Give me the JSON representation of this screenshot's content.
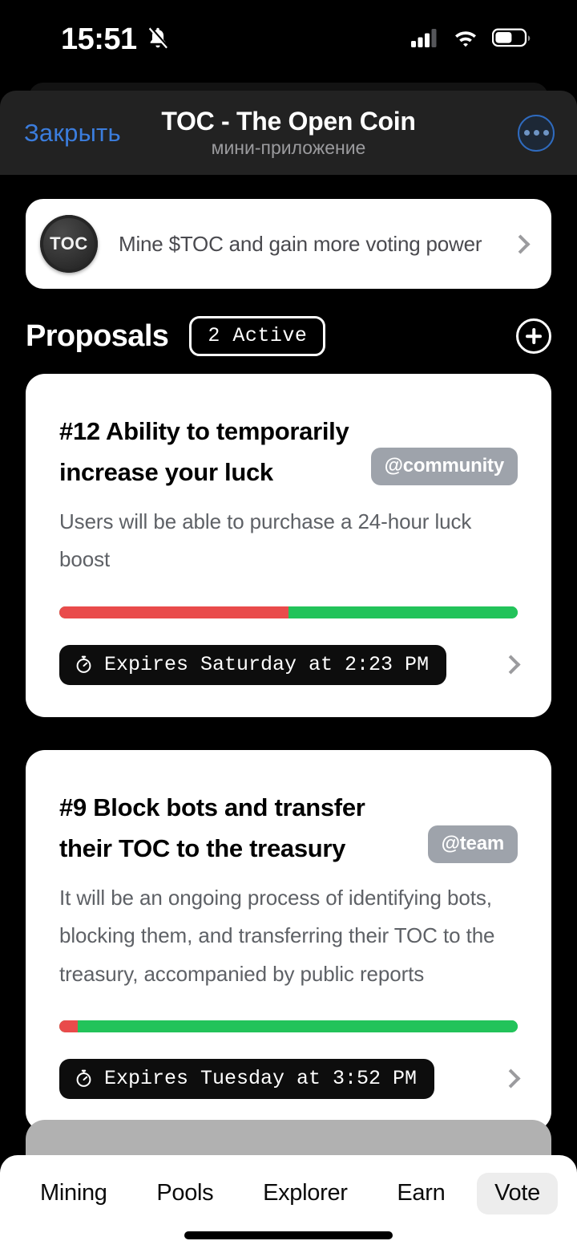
{
  "status_bar": {
    "time": "15:51",
    "silent_icon": "bell-slash-icon",
    "cellular_icon": "cellular-bars-icon",
    "wifi_icon": "wifi-icon",
    "battery_icon": "battery-icon",
    "battery_level_pct": 55
  },
  "header": {
    "close_label": "Закрыть",
    "title": "TOC - The Open Coin",
    "subtitle": "мини-приложение",
    "more_icon": "ellipsis-circle-icon",
    "accent_color": "#3b7ddd",
    "background": "#222222"
  },
  "mine_banner": {
    "coin_label": "TOC",
    "text": "Mine $TOC and gain more voting power",
    "chevron_icon": "chevron-right-icon"
  },
  "proposals": {
    "title": "Proposals",
    "badge": "2 Active",
    "add_icon": "plus-circle-icon",
    "cards": [
      {
        "title": "#12 Ability to temporarily increase your luck",
        "tag": "@community",
        "description": "Users will be able to purchase a 24-hour luck boost",
        "vote_against_pct": 50,
        "vote_for_pct": 50,
        "expires": "Expires Saturday at 2:23 PM",
        "timer_icon": "stopwatch-icon",
        "chevron_icon": "chevron-right-icon"
      },
      {
        "title": "#9 Block bots and transfer their TOC to the treasury",
        "tag": "@team",
        "description": "It will be an ongoing process of identifying bots, blocking them, and transferring their TOC to the treasury, accompanied by public reports",
        "vote_against_pct": 4,
        "vote_for_pct": 96,
        "expires": "Expires Tuesday at 3:52 PM",
        "timer_icon": "stopwatch-icon",
        "chevron_icon": "chevron-right-icon"
      }
    ]
  },
  "colors": {
    "vote_against": "#e94b4b",
    "vote_for": "#22c35a",
    "tag_background": "#9ea3ab",
    "card_background": "#ffffff",
    "peek_card": "#b1b1b1"
  },
  "tabbar": {
    "tabs": [
      {
        "label": "Mining",
        "active": false
      },
      {
        "label": "Pools",
        "active": false
      },
      {
        "label": "Explorer",
        "active": false
      },
      {
        "label": "Earn",
        "active": false
      },
      {
        "label": "Vote",
        "active": true
      }
    ]
  }
}
